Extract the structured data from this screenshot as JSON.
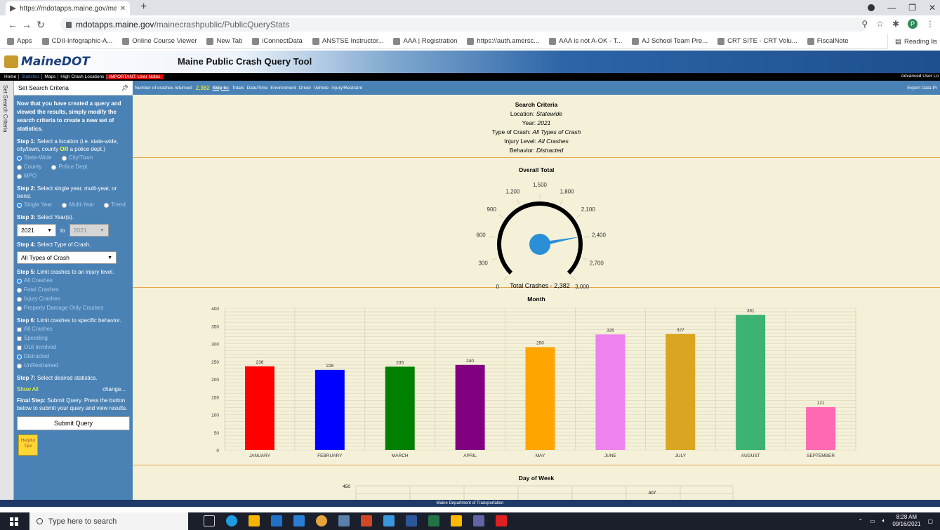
{
  "browser": {
    "tab_title": "https://mdotapps.maine.gov/ma",
    "url_host": "mdotapps.maine.gov",
    "url_path": "/mainecrashpublic/PublicQueryStats",
    "profile_initial": "P",
    "bookmarks": [
      "Apps",
      "CDII-Infographic-A...",
      "Online Course Viewer",
      "New Tab",
      "iConnectData",
      "ANSTSE Instructor...",
      "AAA | Registration",
      "https://auth.amersc...",
      "AAA is not A-OK - T...",
      "AJ School Team Pre...",
      "CRT SITE - CRT Volu...",
      "FiscalNote"
    ],
    "reading_list": "Reading lis"
  },
  "site": {
    "logo_text": "MaineDOT",
    "title": "Maine Public Crash Query Tool",
    "menu": [
      "Home",
      "Statistics",
      "Maps",
      "High Crash Locations",
      "IMPORTANT: User Notes"
    ],
    "advanced": "Advanced User Lo",
    "side_strip": "Set Search Criteria",
    "footer": "Maine Department of Transportation"
  },
  "sidebar": {
    "header": "Set Search Criteria",
    "intro": "Now that you have created a query and viewed the results, simply modify the search criteria to create a new set of statistics.",
    "step1_label": "Step 1:",
    "step1_text_a": "Select a location (i.e. state-wide, city/town, county ",
    "step1_or": "OR",
    "step1_text_b": " a police dept.)",
    "locations": [
      "State-Wide",
      "City/Town",
      "County",
      "Police Dept.",
      "MPO"
    ],
    "step2_label": "Step 2:",
    "step2_text": "Select single year, multi-year, or trend.",
    "year_modes": [
      "Single Year",
      "Multi-Year",
      "Trend"
    ],
    "step3_label": "Step 3:",
    "step3_text": "Select Year(s).",
    "year_from": "2021",
    "year_to_word": "to",
    "year_to": "2021",
    "step4_label": "Step 4:",
    "step4_text": "Select Type of Crash.",
    "crash_type": "All Types of Crash",
    "step5_label": "Step 5:",
    "step5_text": "Limit crashes to an injury level.",
    "injury_levels": [
      "All Crashes",
      "Fatal Crashes",
      "Injury Crashes",
      "Property Damage Only Crashes"
    ],
    "step6_label": "Step 6:",
    "step6_text": "Limit crashes to specific behavior.",
    "behaviors": [
      "All Crashes",
      "Speeding",
      "OUI Involved",
      "Distracted",
      "UnRestrained"
    ],
    "step7_label": "Step 7:",
    "step7_text": "Select desired statistics.",
    "show_all": "Show All",
    "change": "change...",
    "final_label": "Final Step:",
    "final_text": "Submit Query. Press the button below to submit your query and view results.",
    "submit": "Submit Query",
    "helpful_tips": "Helpful Tips"
  },
  "infobar": {
    "returned_label": "Number of crashes returned:",
    "returned_value": "2,382",
    "skip_to": "Skip to:",
    "links": [
      "Totals",
      "Date/Time",
      "Environment",
      "Driver",
      "Vehicle",
      "Injury/Restraint"
    ],
    "export": "Export Data  Pr"
  },
  "criteria": {
    "heading": "Search Criteria",
    "rows": [
      {
        "label": "Location:",
        "value": "Statewide"
      },
      {
        "label": "Year:",
        "value": "2021"
      },
      {
        "label": "Type of Crash:",
        "value": "All Types of Crash"
      },
      {
        "label": "Injury Level:",
        "value": "All Crashes"
      },
      {
        "label": "Behavior:",
        "value": "Distracted"
      }
    ]
  },
  "gauge": {
    "title": "Overall Total",
    "min": 0,
    "max": 3000,
    "value": 2382,
    "ticks": [
      "0",
      "300",
      "600",
      "900",
      "1,200",
      "1,500",
      "1,800",
      "2,100",
      "2,400",
      "2,700",
      "3,000"
    ],
    "caption": "Total Crashes - 2,382",
    "needle_color": "#2a8fd6"
  },
  "chart_data": {
    "type": "bar",
    "title": "Month",
    "categories": [
      "JANUARY",
      "FEBRUARY",
      "MARCH",
      "APRIL",
      "MAY",
      "JUNE",
      "JULY",
      "AUGUST",
      "SEPTEMBER"
    ],
    "values": [
      236,
      226,
      235,
      240,
      290,
      326,
      327,
      381,
      121
    ],
    "colors": [
      "#ff0000",
      "#0000ff",
      "#008000",
      "#800080",
      "#ffa500",
      "#ee82ee",
      "#daa520",
      "#3cb371",
      "#ff69b4"
    ],
    "ylim": [
      0,
      400
    ],
    "yticks": [
      0,
      50,
      100,
      150,
      200,
      250,
      300,
      350,
      400
    ],
    "xlabel": "",
    "ylabel": "",
    "grid": true
  },
  "day_of_week": {
    "title": "Day of Week",
    "visible_ytick": "450",
    "visible_label": "407"
  },
  "taskbar": {
    "search_placeholder": "Type here to search",
    "time": "8:28 AM",
    "date": "09/16/2021"
  }
}
